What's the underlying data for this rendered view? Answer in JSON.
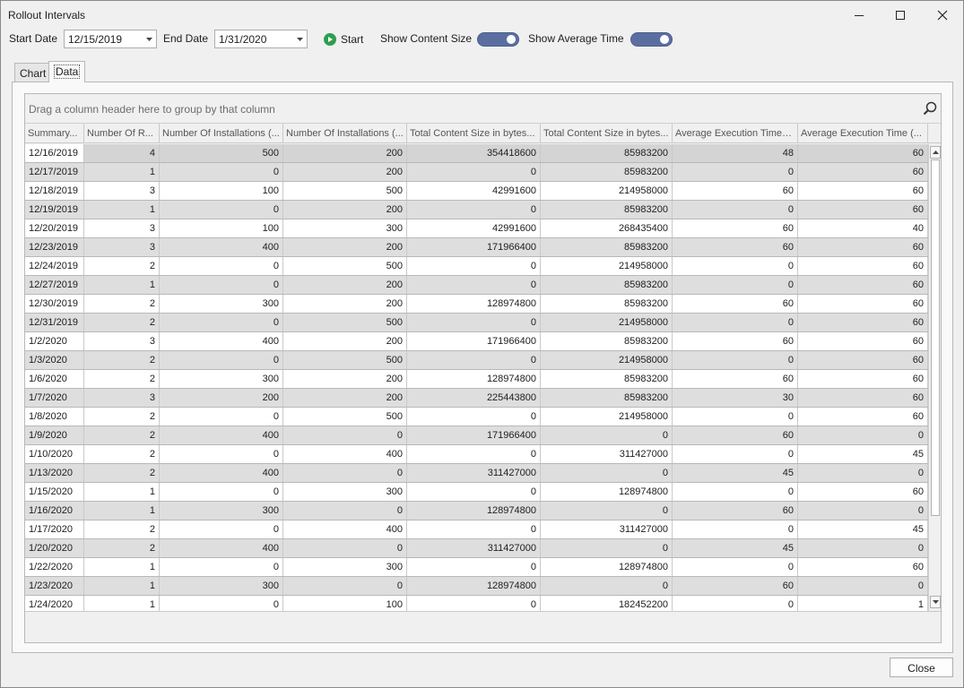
{
  "window": {
    "title": "Rollout Intervals"
  },
  "toolbar": {
    "start_date_label": "Start Date",
    "start_date_value": "12/15/2019",
    "end_date_label": "End Date",
    "end_date_value": "1/31/2020",
    "start_button_label": "Start",
    "show_content_size_label": "Show Content Size",
    "show_content_size_on": true,
    "show_average_time_label": "Show Average Time",
    "show_average_time_on": true
  },
  "tabs": [
    {
      "label": "Chart",
      "active": false
    },
    {
      "label": "Data",
      "active": true
    }
  ],
  "grid": {
    "group_hint": "Drag a column header here to group by that column",
    "headers": [
      "Summary...",
      "Number Of R...",
      "Number Of Installations (...",
      "Number Of Installations (...",
      "Total Content Size in bytes...",
      "Total Content Size in bytes...",
      "Average Execution Time (...",
      "Average Execution Time (..."
    ],
    "rows": [
      [
        "12/16/2019",
        "4",
        "500",
        "200",
        "354418600",
        "85983200",
        "48",
        "60"
      ],
      [
        "12/17/2019",
        "1",
        "0",
        "200",
        "0",
        "85983200",
        "0",
        "60"
      ],
      [
        "12/18/2019",
        "3",
        "100",
        "500",
        "42991600",
        "214958000",
        "60",
        "60"
      ],
      [
        "12/19/2019",
        "1",
        "0",
        "200",
        "0",
        "85983200",
        "0",
        "60"
      ],
      [
        "12/20/2019",
        "3",
        "100",
        "300",
        "42991600",
        "268435400",
        "60",
        "40"
      ],
      [
        "12/23/2019",
        "3",
        "400",
        "200",
        "171966400",
        "85983200",
        "60",
        "60"
      ],
      [
        "12/24/2019",
        "2",
        "0",
        "500",
        "0",
        "214958000",
        "0",
        "60"
      ],
      [
        "12/27/2019",
        "1",
        "0",
        "200",
        "0",
        "85983200",
        "0",
        "60"
      ],
      [
        "12/30/2019",
        "2",
        "300",
        "200",
        "128974800",
        "85983200",
        "60",
        "60"
      ],
      [
        "12/31/2019",
        "2",
        "0",
        "500",
        "0",
        "214958000",
        "0",
        "60"
      ],
      [
        "1/2/2020",
        "3",
        "400",
        "200",
        "171966400",
        "85983200",
        "60",
        "60"
      ],
      [
        "1/3/2020",
        "2",
        "0",
        "500",
        "0",
        "214958000",
        "0",
        "60"
      ],
      [
        "1/6/2020",
        "2",
        "300",
        "200",
        "128974800",
        "85983200",
        "60",
        "60"
      ],
      [
        "1/7/2020",
        "3",
        "200",
        "200",
        "225443800",
        "85983200",
        "30",
        "60"
      ],
      [
        "1/8/2020",
        "2",
        "0",
        "500",
        "0",
        "214958000",
        "0",
        "60"
      ],
      [
        "1/9/2020",
        "2",
        "400",
        "0",
        "171966400",
        "0",
        "60",
        "0"
      ],
      [
        "1/10/2020",
        "2",
        "0",
        "400",
        "0",
        "311427000",
        "0",
        "45"
      ],
      [
        "1/13/2020",
        "2",
        "400",
        "0",
        "311427000",
        "0",
        "45",
        "0"
      ],
      [
        "1/15/2020",
        "1",
        "0",
        "300",
        "0",
        "128974800",
        "0",
        "60"
      ],
      [
        "1/16/2020",
        "1",
        "300",
        "0",
        "128974800",
        "0",
        "60",
        "0"
      ],
      [
        "1/17/2020",
        "2",
        "0",
        "400",
        "0",
        "311427000",
        "0",
        "45"
      ],
      [
        "1/20/2020",
        "2",
        "400",
        "0",
        "311427000",
        "0",
        "45",
        "0"
      ],
      [
        "1/22/2020",
        "1",
        "0",
        "300",
        "0",
        "128974800",
        "0",
        "60"
      ],
      [
        "1/23/2020",
        "1",
        "300",
        "0",
        "128974800",
        "0",
        "60",
        "0"
      ],
      [
        "1/24/2020",
        "1",
        "0",
        "100",
        "0",
        "182452200",
        "0",
        "1"
      ]
    ]
  },
  "footer": {
    "close_label": "Close"
  },
  "colors": {
    "toggle": "#5a6fa0",
    "start_icon": "#2e9e4f"
  }
}
